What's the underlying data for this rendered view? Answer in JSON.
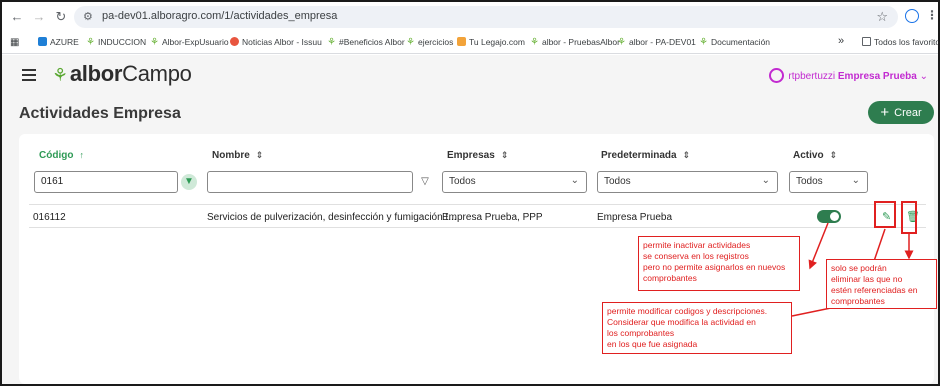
{
  "browser": {
    "url": "pa-dev01.alboragro.com/1/actividades_empresa",
    "bookmarks": [
      "AZURE",
      "INDUCCION",
      "Albor-ExpUsuario",
      "Noticias Albor - Issuu",
      "#Beneficios Albor",
      "ejercicios",
      "Tu Legajo.com",
      "albor - PruebasAlbor",
      "albor - PA-DEV01",
      "Documentación"
    ],
    "more": "»",
    "all_bookmarks": "Todos los favoritos"
  },
  "app": {
    "logo_albor": "albor",
    "logo_campo": "Campo",
    "user_name": "rtpbertuzzi",
    "user_company": "Empresa Prueba",
    "page_title": "Actividades Empresa",
    "crear_label": "Crear"
  },
  "table": {
    "headers": {
      "codigo": "Código",
      "nombre": "Nombre",
      "empresas": "Empresas",
      "predeterminada": "Predeterminada",
      "activo": "Activo"
    },
    "filters": {
      "codigo": "0161",
      "nombre": "",
      "empresas": "Todos",
      "predeterminada": "Todos",
      "activo": "Todos"
    },
    "rows": [
      {
        "codigo": "016112",
        "nombre": "Servicios de pulverización, desinfección y fumigación t...",
        "empresas": "Empresa Prueba, PPP",
        "predeterminada": "Empresa Prueba"
      }
    ]
  },
  "annotations": {
    "inactivar": [
      "permite inactivar actividades",
      "se conserva en los registros",
      "pero no permite asignarlos en nuevos",
      "comprobantes"
    ],
    "eliminar": [
      "solo se podrán",
      "eliminar las que no",
      "estén referenciadas en",
      "comprobantes"
    ],
    "modificar": [
      "permite modificar codigos y descripciones.",
      "Considerar que modifica la actividad en",
      " los comprobantes",
      " en los que fue asignada"
    ]
  },
  "colors": {
    "accent": "#2e7d4f",
    "annotation": "#e02020",
    "user": "#c22ad0"
  }
}
